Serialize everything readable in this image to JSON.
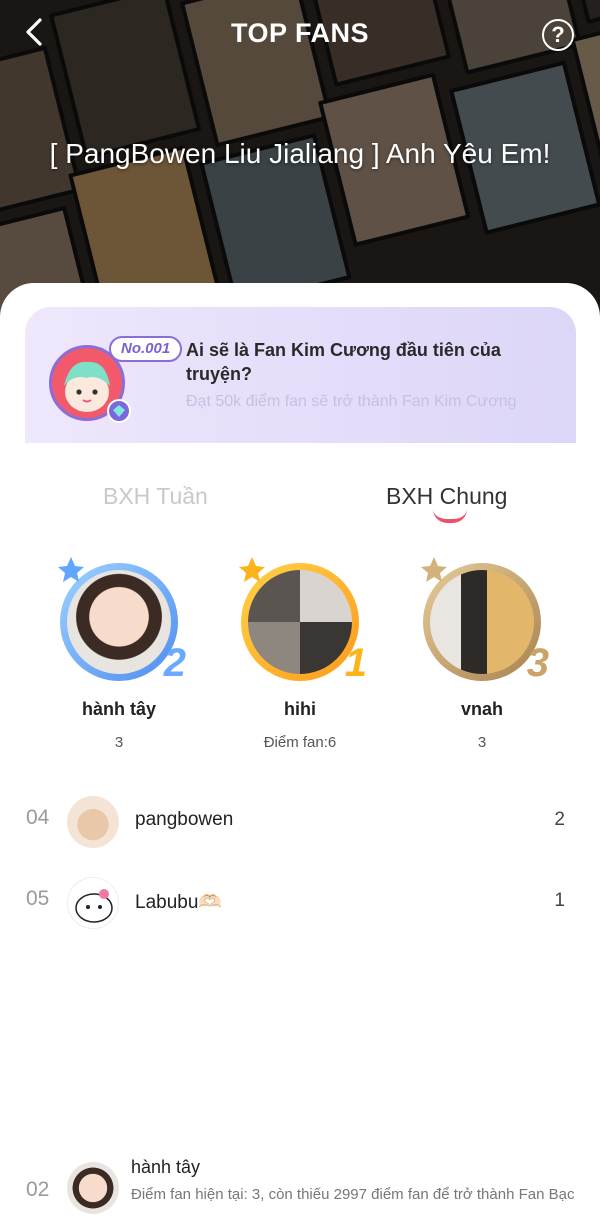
{
  "header": {
    "title": "TOP FANS",
    "back_icon": "chevron-left-icon",
    "help_icon": "question-circle-icon",
    "story_title": "[ PangBowen Liu Jialiang ] Anh Yêu Em!"
  },
  "promo": {
    "badge": "No.001",
    "question": "Ai sẽ là Fan Kim Cương đầu tiên của truyện?",
    "subtext": "Đạt 50k điểm fan sẽ trở thành Fan Kim Cương",
    "gem_icon": "diamond-icon"
  },
  "tabs": [
    {
      "label": "BXH Tuần",
      "active": false
    },
    {
      "label": "BXH Chung",
      "active": true
    }
  ],
  "podium": [
    {
      "rank": "2",
      "name": "hành tây",
      "score": "3",
      "ring_color": "#6aa9ff"
    },
    {
      "rank": "1",
      "name": "hihi",
      "score": "Điểm fan:6",
      "ring_color": "#ffb31a"
    },
    {
      "rank": "3",
      "name": "vnah",
      "score": "3",
      "ring_color": "#c9a36a"
    }
  ],
  "list": [
    {
      "rank": "04",
      "name": "pangbowen",
      "score": "2"
    },
    {
      "rank": "05",
      "name": "Labubu🫶🏻",
      "score": "1"
    }
  ],
  "me": {
    "rank": "02",
    "name": "hành tây",
    "info": "Điểm fan hiện tại: 3, còn thiếu 2997 điểm fan để trở thành Fan Bạc"
  },
  "colors": {
    "accent": "#f0506e",
    "promo_purple": "#8a6ed8",
    "gold": "#ffb31a",
    "silver_blue": "#6aa9ff",
    "bronze": "#c9a36a"
  }
}
